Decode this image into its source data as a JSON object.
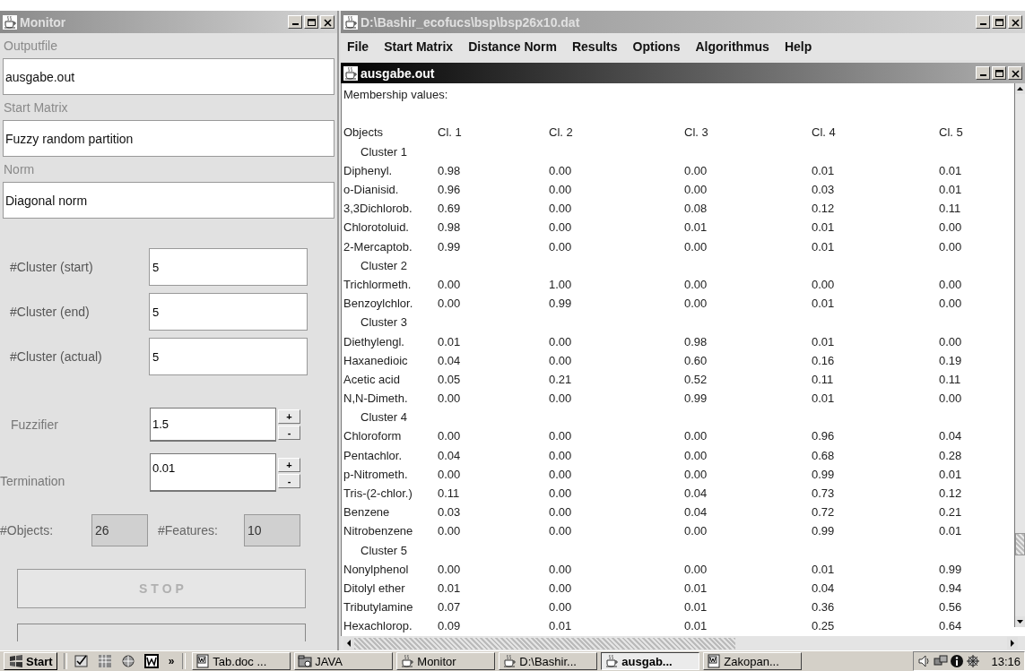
{
  "monitor": {
    "title": "Monitor",
    "fields": [
      {
        "label": "Outputfile",
        "value": "ausgabe.out"
      },
      {
        "label": "Start Matrix",
        "value": "Fuzzy random partition"
      },
      {
        "label": "Norm",
        "value": "Diagonal norm"
      }
    ],
    "counts": [
      {
        "label": "#Cluster (start)",
        "value": "5"
      },
      {
        "label": "#Cluster (end)",
        "value": "5"
      },
      {
        "label": "#Cluster (actual)",
        "value": "5"
      }
    ],
    "spinners": [
      {
        "label": "Fuzzifier",
        "value": "1.5",
        "up": "+",
        "down": "-"
      },
      {
        "label": "Termination",
        "value": "0.01",
        "up": "+",
        "down": "-"
      }
    ],
    "info": [
      {
        "label": "#Objects:",
        "value": "26",
        "disabled": true
      },
      {
        "label": "#Features:",
        "value": "10",
        "disabled": true
      }
    ],
    "stop_button": {
      "label": "S T O P",
      "disabled": true
    }
  },
  "main_window": {
    "title": "D:\\Bashir_ecofucs\\bsp\\bsp26x10.dat",
    "active": false,
    "menu": [
      "File",
      "Start Matrix",
      "Distance Norm",
      "Results",
      "Options",
      "Algorithmus",
      "Help"
    ],
    "document": {
      "title": "ausgabe.out",
      "active": true,
      "heading": "Membership values:",
      "columns": [
        "Objects",
        "Cl. 1",
        "Cl. 2",
        "Cl. 3",
        "Cl. 4",
        "Cl. 5"
      ],
      "rows": [
        {
          "kind": "group",
          "label": "Cluster 1"
        },
        {
          "kind": "data",
          "cells": [
            "Diphenyl.",
            "0.98",
            "0.00",
            "0.00",
            "0.01",
            "0.01"
          ]
        },
        {
          "kind": "data",
          "cells": [
            "o-Dianisid.",
            "0.96",
            "0.00",
            "0.00",
            "0.03",
            "0.01"
          ]
        },
        {
          "kind": "data",
          "cells": [
            "3,3Dichlorob.",
            "0.69",
            "0.00",
            "0.08",
            "0.12",
            "0.11"
          ]
        },
        {
          "kind": "data",
          "cells": [
            "Chlorotoluid.",
            "0.98",
            "0.00",
            "0.01",
            "0.01",
            "0.00"
          ]
        },
        {
          "kind": "data",
          "cells": [
            "2-Mercaptob.",
            "0.99",
            "0.00",
            "0.00",
            "0.01",
            "0.00"
          ]
        },
        {
          "kind": "group",
          "label": "Cluster 2"
        },
        {
          "kind": "data",
          "cells": [
            "Trichlormeth.",
            "0.00",
            "1.00",
            "0.00",
            "0.00",
            "0.00"
          ]
        },
        {
          "kind": "data",
          "cells": [
            "Benzoylchlor.",
            "0.00",
            "0.99",
            "0.00",
            "0.01",
            "0.00"
          ]
        },
        {
          "kind": "group",
          "label": "Cluster 3"
        },
        {
          "kind": "data",
          "cells": [
            "Diethylengl.",
            "0.01",
            "0.00",
            "0.98",
            "0.01",
            "0.00"
          ]
        },
        {
          "kind": "data",
          "cells": [
            "Haxanedioic",
            "0.04",
            "0.00",
            "0.60",
            "0.16",
            "0.19"
          ]
        },
        {
          "kind": "data",
          "cells": [
            "Acetic acid",
            "0.05",
            "0.21",
            "0.52",
            "0.11",
            "0.11"
          ]
        },
        {
          "kind": "data",
          "cells": [
            "N,N-Dimeth.",
            "0.00",
            "0.00",
            "0.99",
            "0.01",
            "0.00"
          ]
        },
        {
          "kind": "group",
          "label": "Cluster 4"
        },
        {
          "kind": "data",
          "cells": [
            "Chloroform",
            "0.00",
            "0.00",
            "0.00",
            "0.96",
            "0.04"
          ]
        },
        {
          "kind": "data",
          "cells": [
            "Pentachlor.",
            "0.04",
            "0.00",
            "0.00",
            "0.68",
            "0.28"
          ]
        },
        {
          "kind": "data",
          "cells": [
            "p-Nitrometh.",
            "0.00",
            "0.00",
            "0.00",
            "0.99",
            "0.01"
          ]
        },
        {
          "kind": "data",
          "cells": [
            "Tris-(2-chlor.)",
            "0.11",
            "0.00",
            "0.04",
            "0.73",
            "0.12"
          ]
        },
        {
          "kind": "data",
          "cells": [
            "Benzene",
            "0.03",
            "0.00",
            "0.04",
            "0.72",
            "0.21"
          ]
        },
        {
          "kind": "data",
          "cells": [
            "Nitrobenzene",
            "0.00",
            "0.00",
            "0.00",
            "0.99",
            "0.01"
          ]
        },
        {
          "kind": "group",
          "label": "Cluster 5"
        },
        {
          "kind": "data",
          "cells": [
            "Nonylphenol",
            "0.00",
            "0.00",
            "0.00",
            "0.01",
            "0.99"
          ]
        },
        {
          "kind": "data",
          "cells": [
            "Ditolyl ether",
            "0.01",
            "0.00",
            "0.01",
            "0.04",
            "0.94"
          ]
        },
        {
          "kind": "data",
          "cells": [
            "Tributylamine",
            "0.07",
            "0.00",
            "0.01",
            "0.36",
            "0.56"
          ]
        },
        {
          "kind": "data",
          "cells": [
            "Hexachlorop.",
            "0.09",
            "0.01",
            "0.01",
            "0.25",
            "0.64"
          ]
        }
      ]
    }
  },
  "taskbar": {
    "start": "Start",
    "more": "»",
    "tasks": [
      {
        "label": "Tab.doc ...",
        "kind": "document",
        "selected": false
      },
      {
        "label": "JAVA",
        "kind": "folder",
        "selected": false
      },
      {
        "label": "Monitor",
        "kind": "program",
        "selected": false
      },
      {
        "label": "D:\\Bashir...",
        "kind": "program",
        "selected": false
      },
      {
        "label": "ausgab...",
        "kind": "program",
        "selected": true
      },
      {
        "label": "Zakopan...",
        "kind": "document",
        "selected": false
      }
    ],
    "clock": "13:16"
  }
}
